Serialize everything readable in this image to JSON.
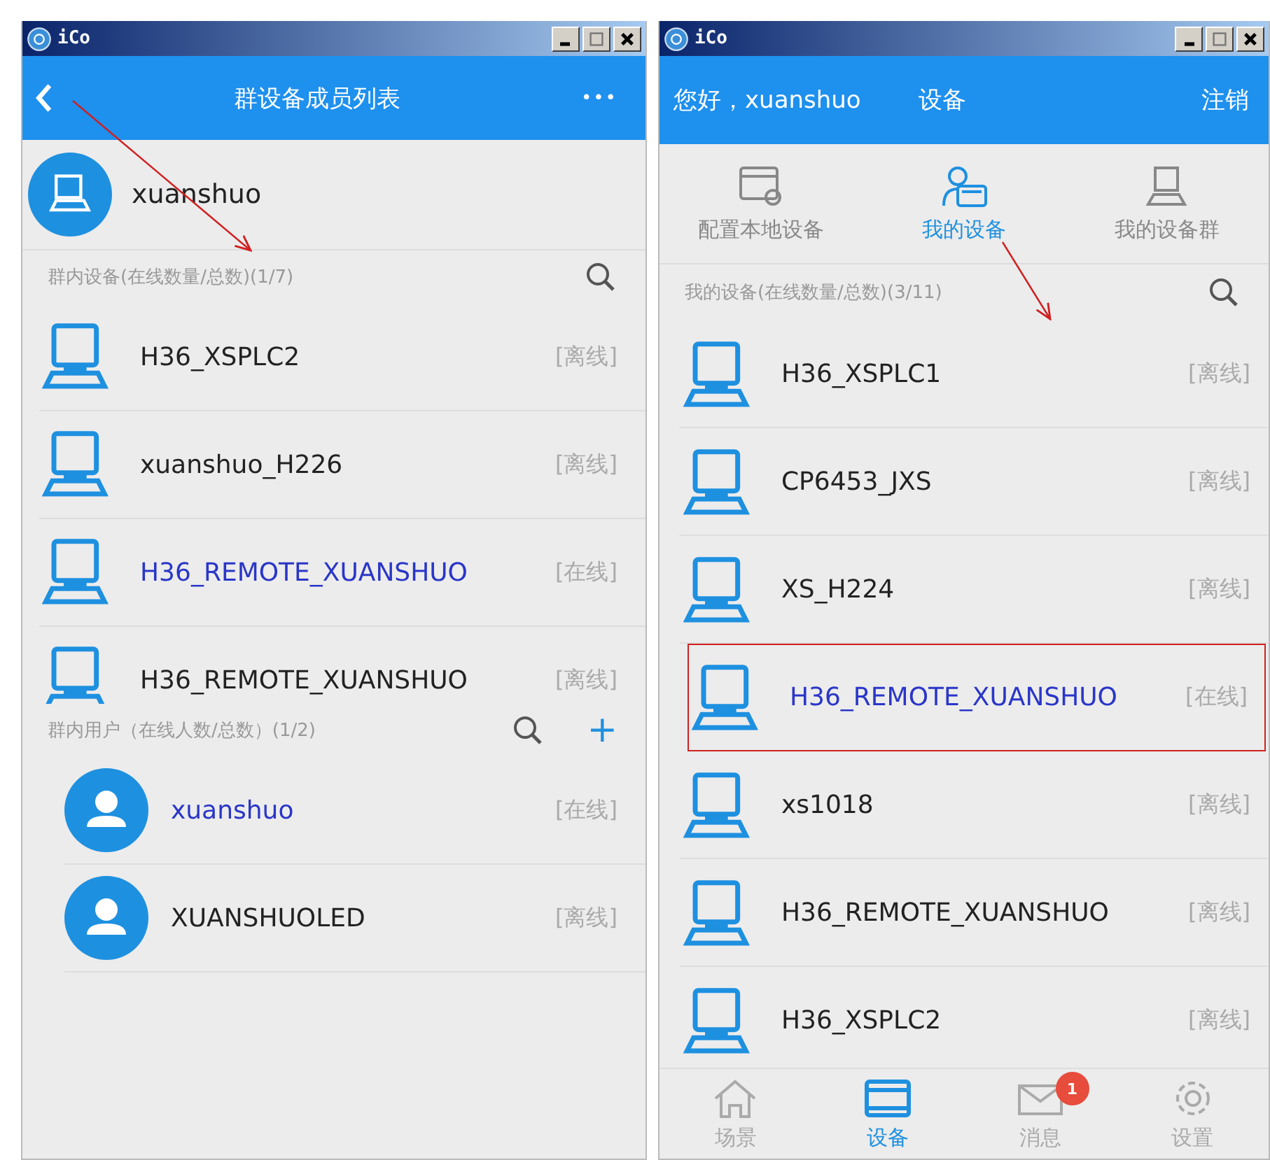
{
  "left_window": {
    "title": "iCo",
    "header": {
      "title": "群设备成员列表",
      "menu": "•••"
    },
    "owner": {
      "name": "xuanshuo"
    },
    "devices_section": {
      "label": "群内设备(在线数量/总数)(1/7)"
    },
    "devices": [
      {
        "name": "H36_XSPLC2",
        "status": "[离线]",
        "online": false
      },
      {
        "name": "xuanshuo_H226",
        "status": "[离线]",
        "online": false
      },
      {
        "name": "H36_REMOTE_XUANSHUO",
        "status": "[在线]",
        "online": true
      },
      {
        "name": "H36_REMOTE_XUANSHUO",
        "status": "[离线]",
        "online": false
      }
    ],
    "users_section": {
      "label": "群内用户（在线人数/总数）(1/2)",
      "add": "+"
    },
    "users": [
      {
        "name": "xuanshuo",
        "status": "[在线]",
        "online": true
      },
      {
        "name": "XUANSHUOLED",
        "status": "[离线]",
        "online": false
      }
    ]
  },
  "right_window": {
    "title": "iCo",
    "header": {
      "greeting": "您好，xuanshuo",
      "title": "设备",
      "logout": "注销"
    },
    "tabs": [
      {
        "label": "配置本地设备",
        "selected": false
      },
      {
        "label": "我的设备",
        "selected": true
      },
      {
        "label": "我的设备群",
        "selected": false
      }
    ],
    "devices_section": {
      "label": "我的设备(在线数量/总数)(3/11)"
    },
    "devices": [
      {
        "name": "H36_XSPLC1",
        "status": "[离线]",
        "online": false,
        "highlighted": false
      },
      {
        "name": "CP6453_JXS",
        "status": "[离线]",
        "online": false,
        "highlighted": false
      },
      {
        "name": "XS_H224",
        "status": "[离线]",
        "online": false,
        "highlighted": false
      },
      {
        "name": "H36_REMOTE_XUANSHUO",
        "status": "[在线]",
        "online": true,
        "highlighted": true
      },
      {
        "name": "xs1018",
        "status": "[离线]",
        "online": false,
        "highlighted": false
      },
      {
        "name": "H36_REMOTE_XUANSHUO",
        "status": "[离线]",
        "online": false,
        "highlighted": false
      },
      {
        "name": "H36_XSPLC2",
        "status": "[离线]",
        "online": false,
        "highlighted": false
      }
    ],
    "nav": [
      {
        "label": "场景",
        "selected": false
      },
      {
        "label": "设备",
        "selected": true
      },
      {
        "label": "消息",
        "selected": false,
        "badge": "1"
      },
      {
        "label": "设置",
        "selected": false
      }
    ]
  }
}
